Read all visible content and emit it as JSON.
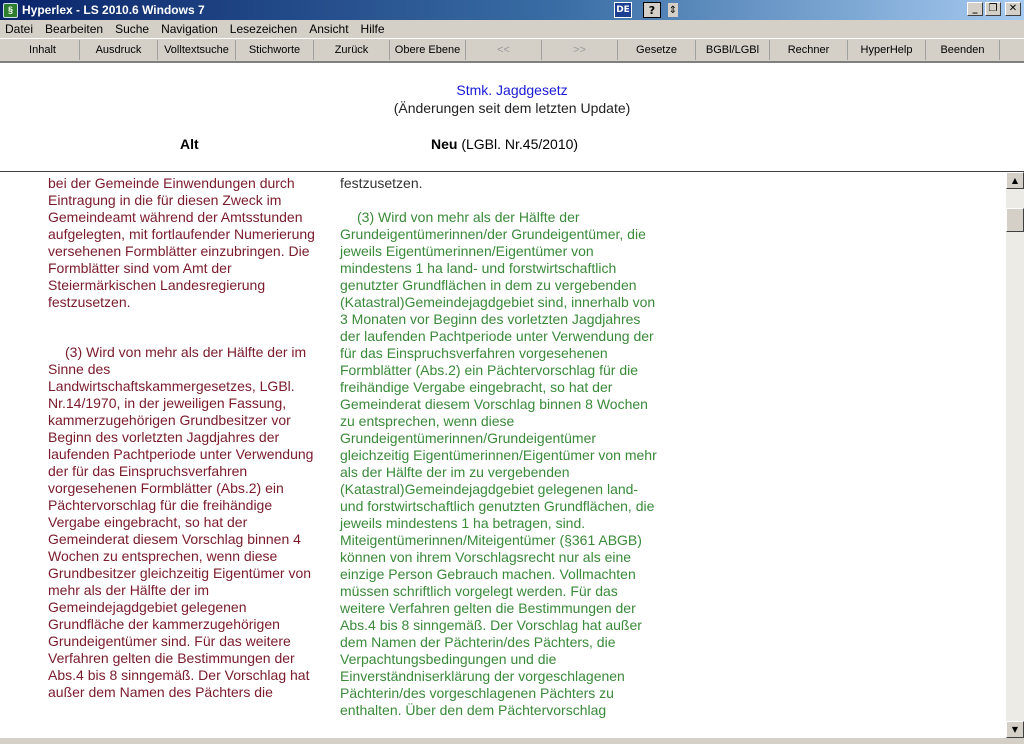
{
  "window": {
    "title": "Hyperlex - LS 2010.6 Windows 7",
    "lang_badge": "DE",
    "help_badge": "?",
    "tray_menu": "⇕",
    "minimize": "_",
    "maximize": "❐",
    "close": "✕"
  },
  "menu": {
    "items": [
      "Datei",
      "Bearbeiten",
      "Suche",
      "Navigation",
      "Lesezeichen",
      "Ansicht",
      "Hilfe"
    ]
  },
  "toolbar": {
    "buttons": [
      "Inhalt",
      "Ausdruck",
      "Volltextsuche",
      "Stichworte",
      "Zurück",
      "Obere Ebene",
      "<<",
      ">>",
      "Gesetze",
      "BGBl/LGBl",
      "Rechner",
      "HyperHelp",
      "Beenden"
    ]
  },
  "header": {
    "title": "Stmk. Jagdgesetz",
    "subtitle": "(Änderungen seit dem letzten Update)",
    "col_alt": "Alt",
    "col_neu_label": "Neu",
    "col_neu_ref": " (LGBl. Nr.45/2010)"
  },
  "content": {
    "alt_para1": "bei der Gemeinde Einwendungen durch Eintragung in die für diesen Zweck im Gemeindeamt während der Amtsstunden aufgelegten, mit fortlaufender Numerierung versehenen Formblätter einzubringen. Die Formblätter sind vom Amt der Steiermärkischen Landesregierung festzusetzen.",
    "alt_para2": "(3) Wird von mehr als der Hälfte der im Sinne des Landwirtschaftskammergesetzes, LGBl. Nr.14/1970, in der jeweiligen Fassung, kammerzugehörigen Grundbesitzer vor Beginn des vorletzten Jagdjahres der laufenden Pachtperiode unter Verwendung der für das Einspruchsverfahren vorgesehenen Formblätter (Abs.2) ein Pächtervorschlag für die freihändige Vergabe eingebracht, so hat der Gemeinderat diesem Vorschlag binnen 4 Wochen zu entsprechen, wenn diese Grundbesitzer gleichzeitig Eigentümer von mehr als der Hälfte der im Gemeindejagdgebiet gelegenen Grundfläche der kammerzugehörigen Grundeigentümer sind. Für das weitere Verfahren gelten die Bestimmungen der Abs.4 bis 8 sinngemäß. Der Vorschlag hat außer dem Namen des Pächters die",
    "neu_para1": "festzusetzen.",
    "neu_para2": "(3) Wird von mehr als der Hälfte der Grundeigentümerinnen/der Grundeigentümer, die jeweils Eigentümerinnen/Eigentümer von mindestens 1 ha land- und forstwirtschaftlich genutzter Grundflächen in dem zu vergebenden (Katastral)Gemeindejagdgebiet sind, innerhalb von 3 Monaten vor Beginn des vorletzten Jagdjahres der laufenden Pachtperiode unter Verwendung der für das Einspruchsverfahren vorgesehenen Formblätter (Abs.2) ein Pächtervorschlag für die freihändige Vergabe eingebracht, so hat der Gemeinderat diesem Vorschlag binnen 8 Wochen zu entsprechen, wenn diese Grundeigentümerinnen/Grundeigentümer gleichzeitig Eigentümerinnen/Eigentümer von mehr als der Hälfte der im zu vergebenden (Katastral)Gemeindejagdgebiet gelegenen land- und forstwirtschaftlich genutzten Grundflächen, die jeweils mindestens 1 ha betragen, sind. Miteigentümerinnen/Miteigentümer (§361 ABGB) können von ihrem Vorschlagsrecht nur als eine einzige Person Gebrauch machen. Vollmachten müssen schriftlich vorgelegt werden. Für das weitere Verfahren gelten die Bestimmungen der Abs.4 bis 8 sinngemäß. Der Vorschlag hat außer dem Namen der Pächterin/des Pächters, die Verpachtungsbedingungen und die Einverständniserklärung der vorgeschlagenen Pächterin/des vorgeschlagenen Pächters zu enthalten. Über den dem Pächtervorschlag"
  },
  "scrollbar": {
    "up": "▲",
    "down": "▼"
  },
  "colors": {
    "title_blue": "#1a1ad6",
    "alt_text": "#7a1a2a",
    "neu_text": "#3a8a3a"
  }
}
